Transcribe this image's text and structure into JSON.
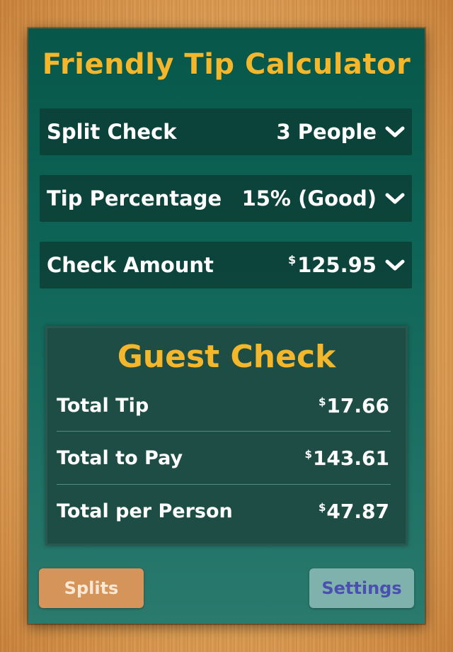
{
  "app": {
    "title": "Friendly Tip Calculator"
  },
  "settings_rows": [
    {
      "label": "Split Check",
      "currency": "",
      "value": "3 People",
      "icon": "chevron-down-icon"
    },
    {
      "label": "Tip Percentage",
      "currency": "",
      "value": "15% (Good)",
      "icon": "chevron-down-icon"
    },
    {
      "label": "Check Amount",
      "currency": "$",
      "value": "125.95",
      "icon": "chevron-down-icon"
    }
  ],
  "guest_check": {
    "title": "Guest Check",
    "rows": [
      {
        "label": "Total Tip",
        "currency": "$",
        "value": "17.66"
      },
      {
        "label": "Total to Pay",
        "currency": "$",
        "value": "143.61"
      },
      {
        "label": "Total per Person",
        "currency": "$",
        "value": "47.87"
      }
    ]
  },
  "buttons": {
    "splits": "Splits",
    "settings": "Settings"
  },
  "colors": {
    "accent": "#f4b62a",
    "board": "#0d6456",
    "splits_button": "#d5955a",
    "settings_button": "#7fb1ad",
    "settings_text": "#4a4fb0"
  }
}
